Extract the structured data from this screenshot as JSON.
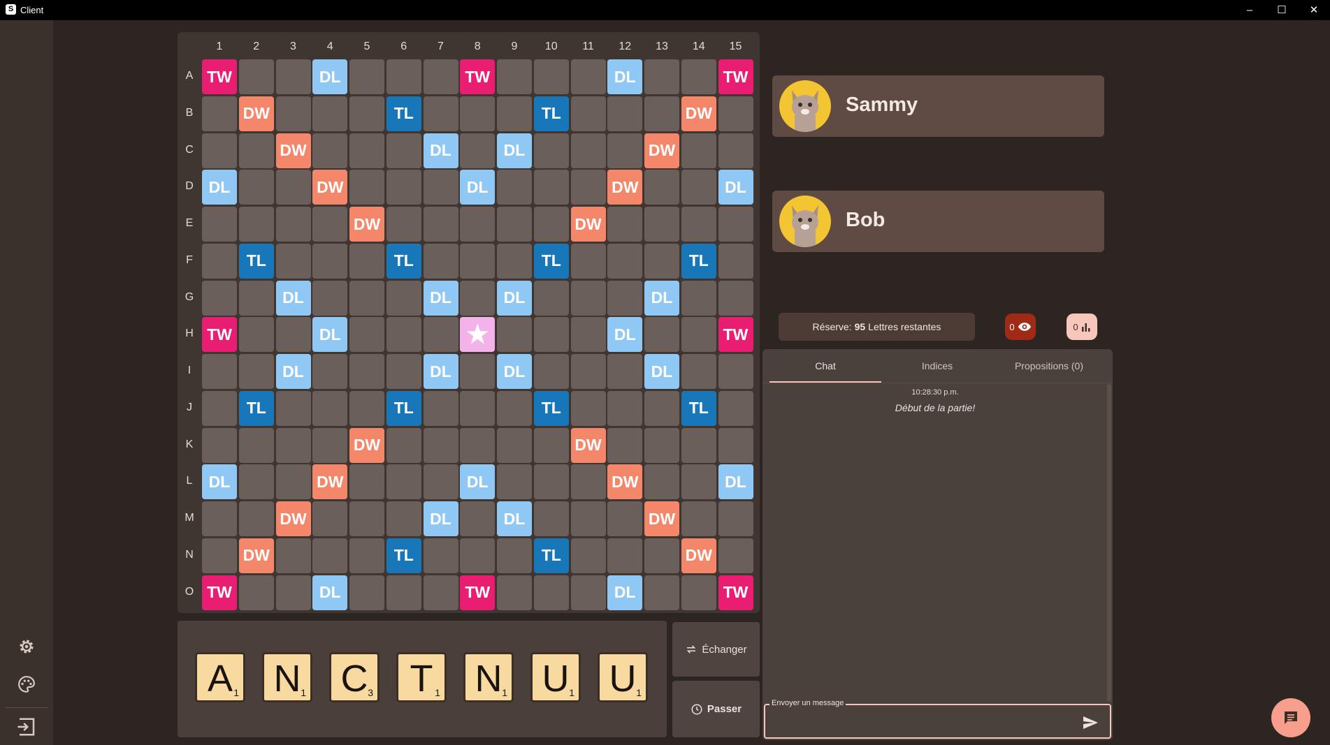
{
  "window": {
    "title": "Client",
    "icon_letter": "S",
    "controls": [
      "–",
      "☐",
      "✕"
    ]
  },
  "board": {
    "columns": [
      "1",
      "2",
      "3",
      "4",
      "5",
      "6",
      "7",
      "8",
      "9",
      "10",
      "11",
      "12",
      "13",
      "14",
      "15"
    ],
    "rows": [
      "A",
      "B",
      "C",
      "D",
      "E",
      "F",
      "G",
      "H",
      "I",
      "J",
      "K",
      "L",
      "M",
      "N",
      "O"
    ],
    "labels": {
      "tw": "TW",
      "dw": "DW",
      "dl": "DL",
      "tl": "TL",
      "star": "★"
    },
    "grid": [
      "t..d...t...d..t",
      ".w...T...T...w.",
      "..w...d.d...w..",
      "d..w...d...w..d",
      "....w.....w....",
      ".T...T...T...T.",
      "..d...d.d...d..",
      "t..d...s...d..t",
      "..d...d.d...d..",
      ".T...T...T...T.",
      "....w.....w....",
      "d..w...d...w..d",
      "..w...d.d...w..",
      ".w...T...T...w.",
      "t..d...t...d..t"
    ]
  },
  "rack": {
    "tiles": [
      {
        "letter": "A",
        "points": "1"
      },
      {
        "letter": "N",
        "points": "1"
      },
      {
        "letter": "C",
        "points": "3"
      },
      {
        "letter": "T",
        "points": "1"
      },
      {
        "letter": "N",
        "points": "1"
      },
      {
        "letter": "U",
        "points": "1"
      },
      {
        "letter": "U",
        "points": "1"
      }
    ],
    "exchange_label": "Échanger",
    "pass_label": "Passer"
  },
  "players": [
    {
      "name": "Sammy"
    },
    {
      "name": "Bob"
    }
  ],
  "reserve": {
    "prefix": "Réserve:",
    "count": "95",
    "suffix": "Lettres restantes"
  },
  "hints_count": "0",
  "stats_count": "0",
  "tabs": [
    {
      "label": "Chat",
      "active": true
    },
    {
      "label": "Indices",
      "active": false
    },
    {
      "label": "Propositions (0)",
      "active": false
    }
  ],
  "chat": {
    "messages": [
      {
        "time": "10:28:30 p.m.",
        "text": "Début de la partie!"
      }
    ],
    "input_label": "Envoyer un message",
    "input_value": ""
  },
  "colors": {
    "tw": "#e91e73",
    "dw": "#f4866a",
    "dl": "#8fc8f5",
    "tl": "#1877b8",
    "star": "#f3b2e9",
    "empty": "#6b5f5b",
    "accent": "#f79f8c"
  }
}
